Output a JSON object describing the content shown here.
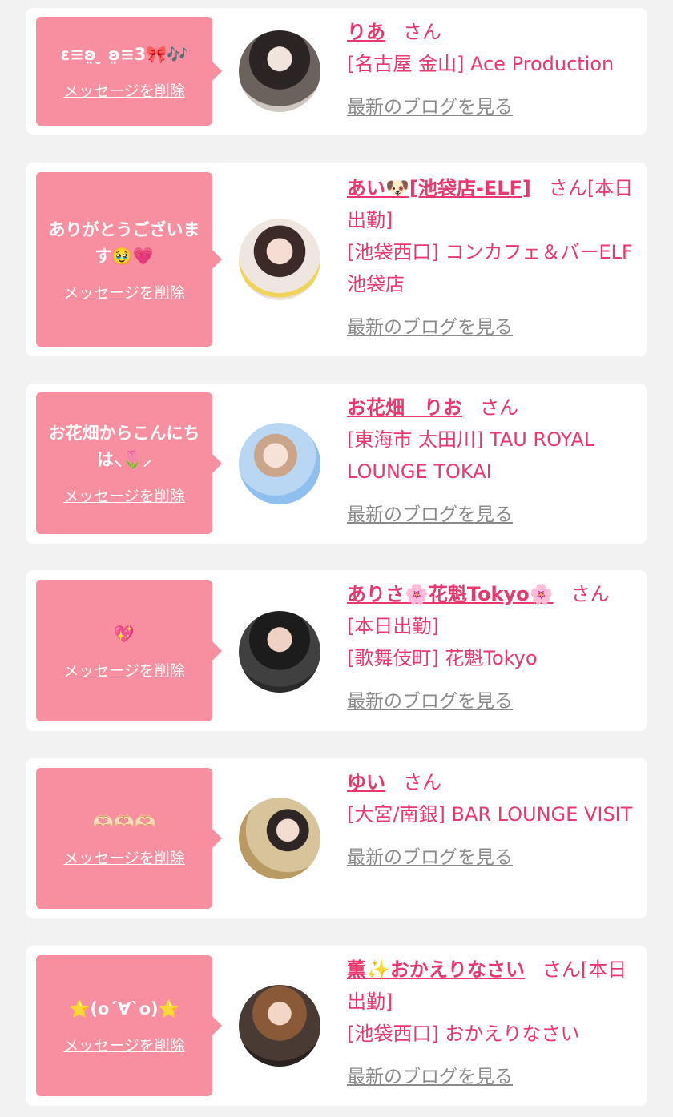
{
  "colors": {
    "accent": "#e8386d",
    "bubble": "#f88fa0",
    "background": "#f2f2f2",
    "blog_link": "#8a8a8a"
  },
  "delete_label": "メッセージを削除",
  "blog_label": "最新のブログを見る",
  "messages": [
    {
      "message": "ɛ≡ʚ̤ ̮ ʚ̤≡3🎀🎶",
      "name": "りあ",
      "honorific": "さん",
      "shop": "[名古屋 金山] Ace Production"
    },
    {
      "message": "ありがとうございます🥹💗",
      "name": "あい🐶[池袋店-ELF]",
      "honorific": "さん[本日出勤]",
      "shop": "[池袋西口] コンカフェ＆バーELF 池袋店"
    },
    {
      "message": "お花畑からこんにちは⸜🌷⸝",
      "name": "お花畑　りお",
      "honorific": "さん",
      "shop": "[東海市 太田川] TAU ROYAL LOUNGE TOKAI"
    },
    {
      "message": "💖",
      "name": "ありさ🌸花魁Tokyo🌸",
      "honorific": "さん[本日出勤]",
      "shop": "[歌舞伎町] 花魁Tokyo"
    },
    {
      "message": "🫶🏻🫶🏻🫶🏻",
      "name": "ゆい",
      "honorific": "さん",
      "shop": "[大宮/南銀]  BAR LOUNGE VISIT"
    },
    {
      "message": "⭐️(o´∀`o)⭐️",
      "name": "薫✨おかえりなさい",
      "honorific": "さん[本日出勤]",
      "shop": "[池袋西口] おかえりなさい"
    }
  ]
}
